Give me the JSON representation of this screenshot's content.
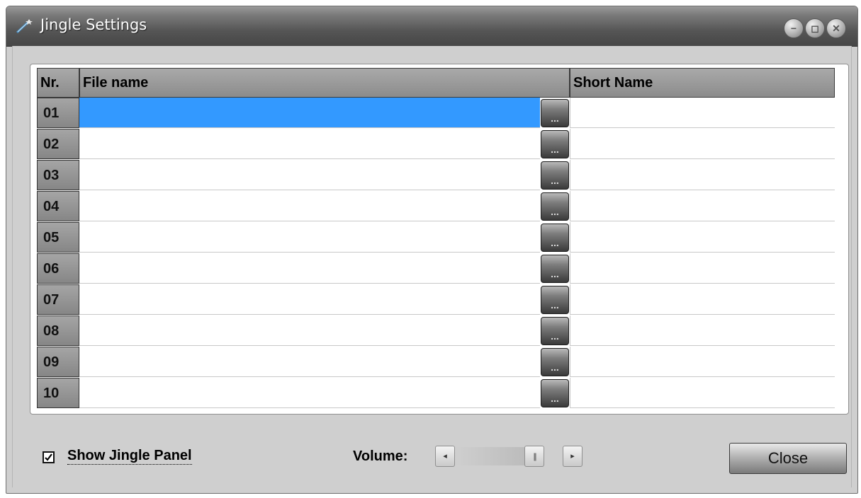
{
  "window": {
    "title": "Jingle Settings",
    "controls": {
      "minimize": "−",
      "restore": "◻",
      "close": "✕"
    }
  },
  "table": {
    "headers": {
      "nr": "Nr.",
      "file_name": "File name",
      "short_name": "Short Name"
    },
    "browse_label": "...",
    "rows": [
      {
        "nr": "01",
        "file": "",
        "short": "",
        "selected": true
      },
      {
        "nr": "02",
        "file": "",
        "short": ""
      },
      {
        "nr": "03",
        "file": "",
        "short": ""
      },
      {
        "nr": "04",
        "file": "",
        "short": ""
      },
      {
        "nr": "05",
        "file": "",
        "short": ""
      },
      {
        "nr": "06",
        "file": "",
        "short": ""
      },
      {
        "nr": "07",
        "file": "",
        "short": ""
      },
      {
        "nr": "08",
        "file": "",
        "short": ""
      },
      {
        "nr": "09",
        "file": "",
        "short": ""
      },
      {
        "nr": "10",
        "file": "",
        "short": ""
      }
    ]
  },
  "footer": {
    "show_panel_label": "Show Jingle Panel",
    "show_panel_checked": true,
    "check_mark": "✓",
    "volume_label": "Volume:",
    "volume_level": 0.82,
    "slider_left_arrow": "◂",
    "slider_right_arrow": "▸",
    "slider_thumb": "|||",
    "close_label": "Close"
  },
  "colors": {
    "selection": "#3399ff",
    "title_bar": "#555555"
  }
}
